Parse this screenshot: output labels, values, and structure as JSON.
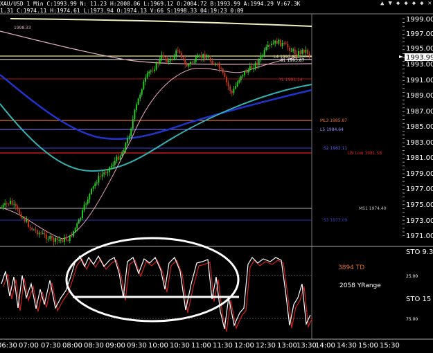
{
  "header": {
    "line1": "XAU/USD 1 Min  C:1993.99  N:  11.23  H:2008.06  L:1969.12  O:2004.72  B:1993.99  A:1994.29  V:67.3K",
    "line2": "1.31  C:1974.11  H:1974.61  L:1973.94  O:1974.13  V:66  S:1998.33  04:19:23  0:09"
  },
  "window_controls": [
    "▲",
    "▼",
    "◆",
    "◆",
    "◆",
    "◆",
    "✕"
  ],
  "price_axis": {
    "labels": [
      "1999.00",
      "1997.00",
      "1995.00",
      "1993.00",
      "1991.00",
      "1989.00",
      "1987.00",
      "1985.00",
      "1983.00",
      "1981.00",
      "1979.00",
      "1977.00",
      "1975.00",
      "1973.00",
      "1971.00"
    ],
    "current_price": "1993.99"
  },
  "time_axis": {
    "labels": [
      "06:30",
      "07:00",
      "07:30",
      "08:00",
      "08:30",
      "09:00",
      "09:30",
      "10:00",
      "10:30",
      "11:00",
      "11:30",
      "12:00",
      "12:30",
      "13:00",
      "13:30",
      "14:00",
      "14:30",
      "15:00",
      "15:30"
    ]
  },
  "level_labels": {
    "top_ma": "1998.33",
    "l4": "L4 1993.80",
    "s1": "S1 1993.87",
    "yl": "YL 1991.14",
    "ml3": "ML3 1985.87",
    "l5": "L5 1984.64",
    "s2": "S2 1982.11",
    "lw_low": "LW Low 1981.58",
    "ms1": "MS1 1974.40",
    "s3": "S3 1973.09"
  },
  "stoch_panel": {
    "top_label": "STO  9.3",
    "right_label": "STO  15",
    "ticks": [
      "25.00",
      "75.00"
    ],
    "td_text": "3894 TD",
    "yrange_text": "2058 YRange"
  },
  "colors": {
    "background": "#000000",
    "candle_up": "#22dd22",
    "candle_down": "#cc3a1a",
    "ma_blue": "#2233cc",
    "ma_teal": "#35b3b3",
    "ma_pink": "#e0b0c0",
    "ma_yellow": "#f0f0c0",
    "stoch_k": "#ffffff",
    "stoch_d": "#d02020",
    "td_text": "#e07030"
  }
}
